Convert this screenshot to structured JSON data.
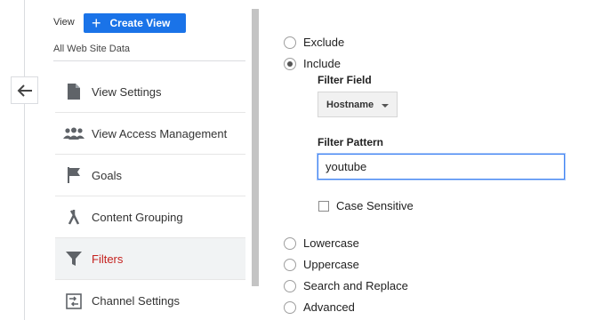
{
  "left_panel": {
    "view_label": "View",
    "create_view_label": "Create View",
    "view_name": "All Web Site Data",
    "nav_items": [
      {
        "label": "View Settings",
        "icon": "document-icon"
      },
      {
        "label": "View Access Management",
        "icon": "people-icon"
      },
      {
        "label": "Goals",
        "icon": "flag-icon"
      },
      {
        "label": "Content Grouping",
        "icon": "content-grouping-icon"
      },
      {
        "label": "Filters",
        "icon": "filter-icon",
        "active": true
      },
      {
        "label": "Channel Settings",
        "icon": "channel-settings-icon"
      }
    ]
  },
  "filter_form": {
    "exclude_label": "Exclude",
    "include_label": "Include",
    "selected_type": "Include",
    "filter_field_label": "Filter Field",
    "filter_field_value": "Hostname",
    "filter_pattern_label": "Filter Pattern",
    "filter_pattern_value": "youtube",
    "case_sensitive_label": "Case Sensitive",
    "case_sensitive_checked": false,
    "other_options": [
      "Lowercase",
      "Uppercase",
      "Search and Replace",
      "Advanced"
    ]
  },
  "colors": {
    "accent": "#1a73e8",
    "active_nav": "#c5221f",
    "input_focus": "#4285f4"
  }
}
